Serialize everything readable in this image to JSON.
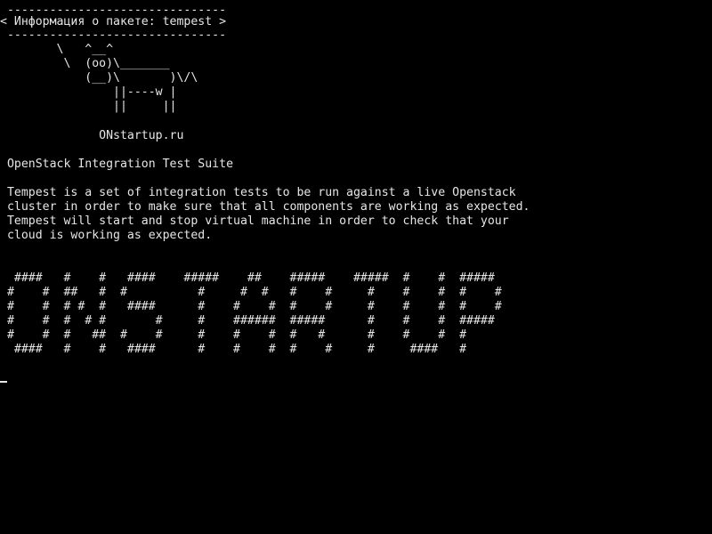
{
  "terminal": {
    "banner": {
      "top_rule": " -------------------------------",
      "title": "< Информация о пакете: tempest >",
      "bottom_rule": " -------------------------------",
      "cow": [
        "        \\   ^__^",
        "         \\  (oo)\\_______",
        "            (__)\\       )\\/\\",
        "                ||----w |",
        "                ||     ||"
      ],
      "site": "              ONstartup.ru"
    },
    "heading": " OpenStack Integration Test Suite",
    "description": [
      " Tempest is a set of integration tests to be run against a live Openstack",
      " cluster in order to make sure that all components are working as expected.",
      " Tempest will start and stop virtual machine in order to check that your",
      " cloud is working as expected."
    ],
    "ascii_art": [
      "  ####   #    #   ####    #####    ##    #####    #####  #    #  #####",
      " #    #  ##   #  #          #     #  #   #    #     #    #    #  #    #",
      " #    #  # #  #   ####      #    #    #  #    #     #    #    #  #    #",
      " #    #  #  # #       #     #    ######  #####      #    #    #  #####",
      " #    #  #   ##  #    #     #    #    #  #   #      #    #    #  #",
      "  ####   #    #   ####      #    #    #  #    #     #     ####   #"
    ],
    "cursor_glyph": "block-cursor"
  }
}
